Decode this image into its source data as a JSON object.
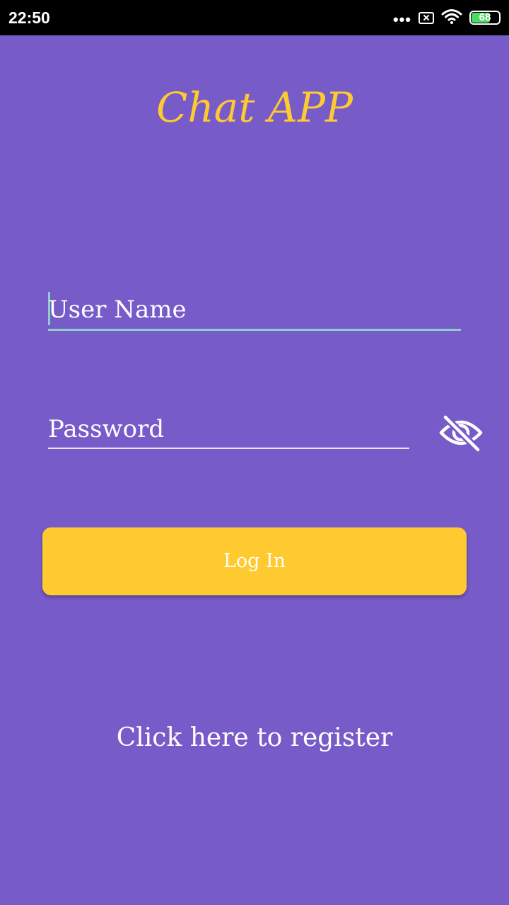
{
  "status_bar": {
    "time": "22:50",
    "signal_dots": "•••",
    "battery_level": "68",
    "battery_fraction": 0.68,
    "icons": [
      "more-dots-icon",
      "no-sim-icon",
      "wifi-icon",
      "battery-icon"
    ]
  },
  "app": {
    "title": "Chat APP"
  },
  "form": {
    "username_placeholder": "User Name",
    "password_placeholder": "Password",
    "password_toggle_icon": "eye-off-icon",
    "login_label": "Log In",
    "register_label": "Click here to register"
  },
  "colors": {
    "background": "#765bc9",
    "title": "#ffc931",
    "button": "#ffca2f",
    "focus_underline": "#8ad0c8",
    "text": "#ffffff"
  }
}
